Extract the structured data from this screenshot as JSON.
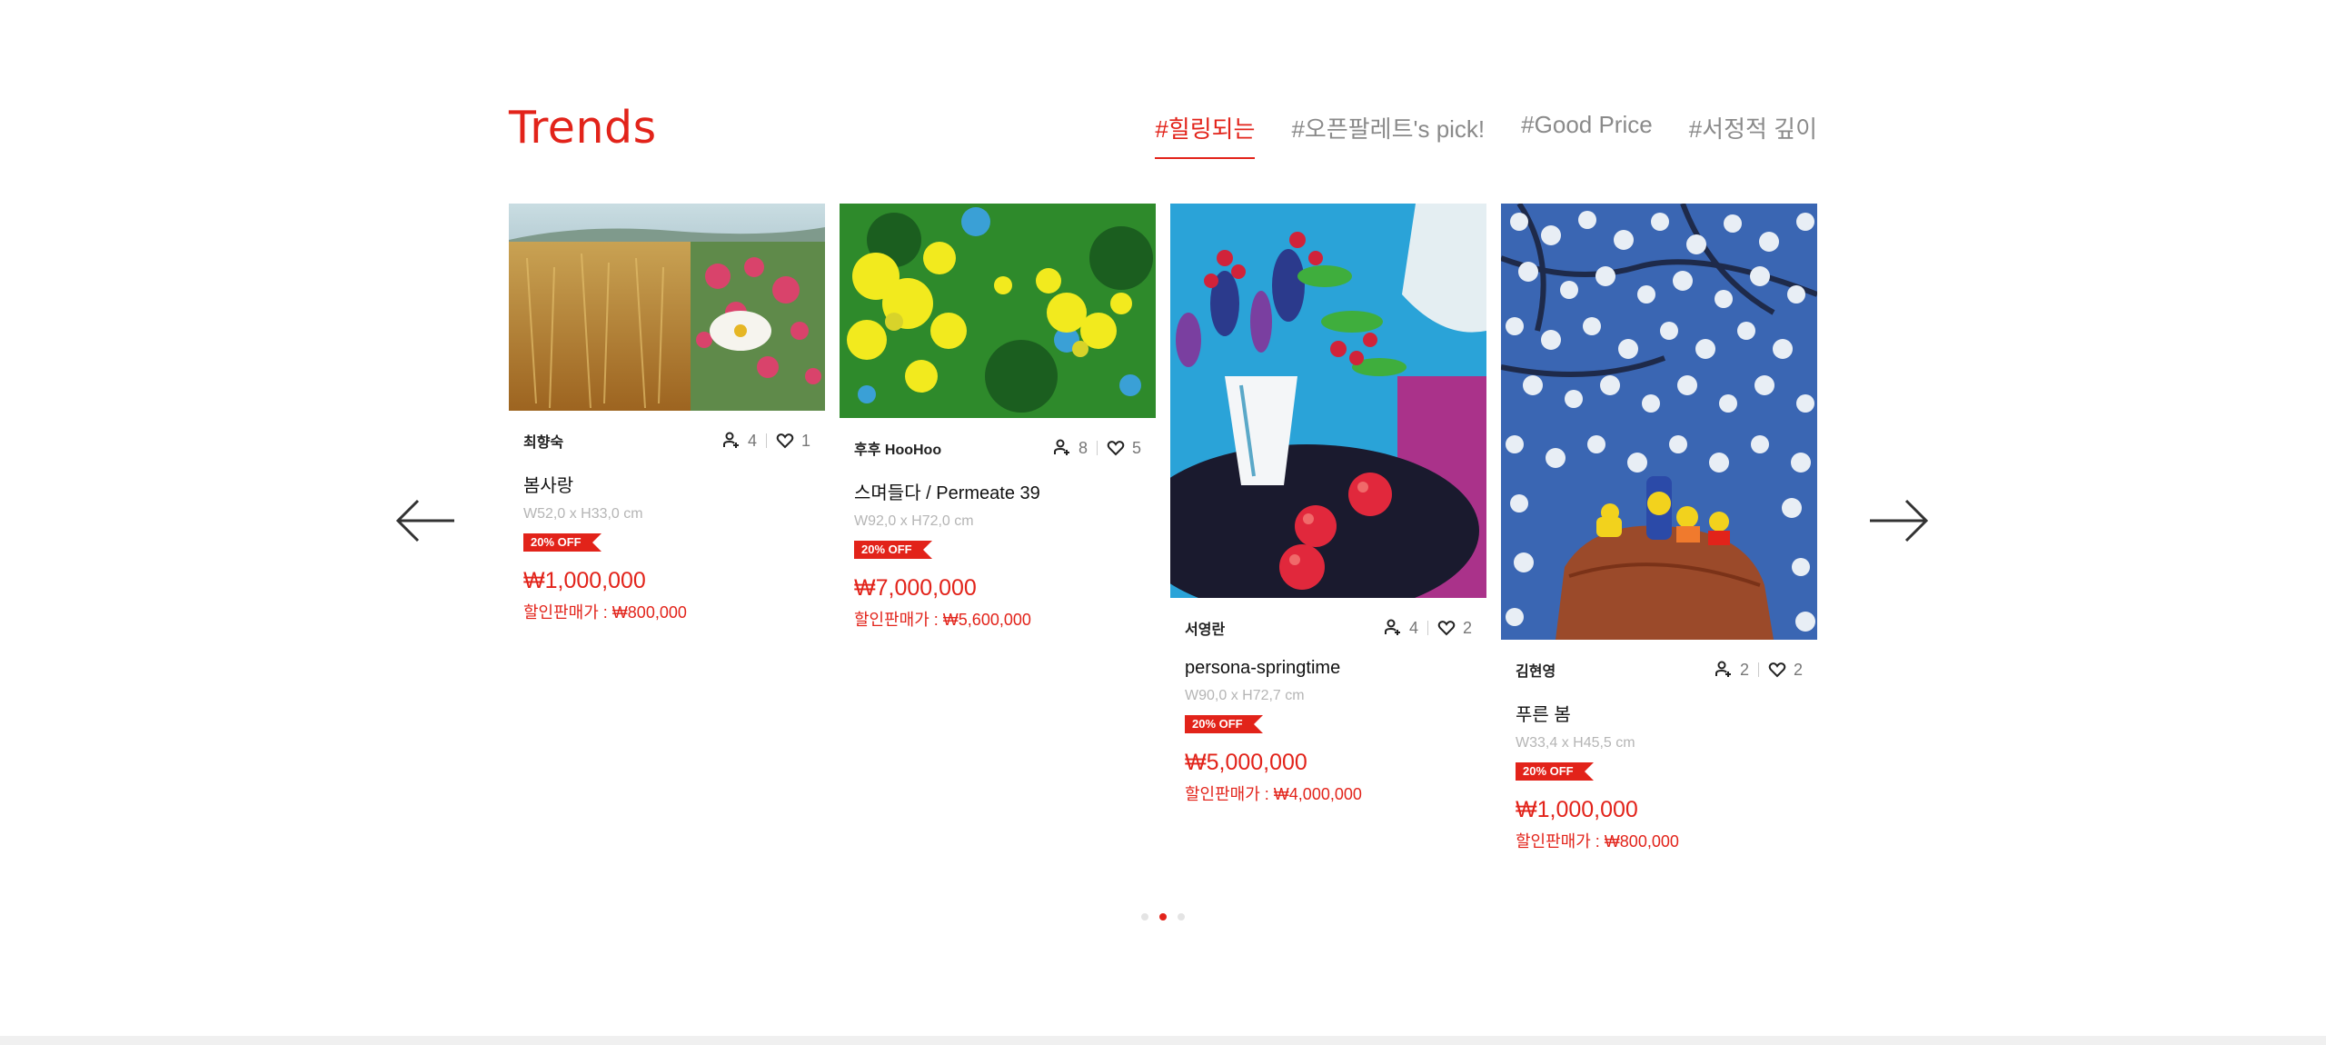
{
  "section": {
    "title": "Trends"
  },
  "tabs": [
    {
      "label": "#힐링되는",
      "active": true
    },
    {
      "label": "#오픈팔레트's pick!",
      "active": false
    },
    {
      "label": "#Good Price",
      "active": false
    },
    {
      "label": "#서정적 깊이",
      "active": false
    }
  ],
  "nav": {
    "prev_icon": "arrow-left-icon",
    "next_icon": "arrow-right-icon"
  },
  "cards": [
    {
      "artist": "최향숙",
      "followers": "4",
      "likes": "1",
      "title": "봄사랑",
      "size": "W52,0 x H33,0 cm",
      "badge": "20% OFF",
      "price": "₩1,000,000",
      "sale": "할인판매가 : ₩800,000",
      "art": "wheat field with poppies"
    },
    {
      "artist": "후후 HooHoo",
      "followers": "8",
      "likes": "5",
      "title": "스며들다 / Permeate 39",
      "size": "W92,0 x H72,0 cm",
      "badge": "20% OFF",
      "price": "₩7,000,000",
      "sale": "할인판매가 : ₩5,600,000",
      "art": "yellow flowers on green"
    },
    {
      "artist": "서영란",
      "followers": "4",
      "likes": "2",
      "title": "persona-springtime",
      "size": "W90,0 x H72,7 cm",
      "badge": "20% OFF",
      "price": "₩5,000,000",
      "sale": "할인판매가 : ₩4,000,000",
      "art": "vase with red berries and apples"
    },
    {
      "artist": "김현영",
      "followers": "2",
      "likes": "2",
      "title": "푸른 봄",
      "size": "W33,4 x H45,5 cm",
      "badge": "20% OFF",
      "price": "₩1,000,000",
      "sale": "할인판매가 : ₩800,000",
      "art": "white blossoms and cartoon family on sofa"
    }
  ],
  "pagination": {
    "count": 3,
    "active": 2
  },
  "colors": {
    "accent": "#e2231a",
    "muted": "#8a8a8a"
  }
}
